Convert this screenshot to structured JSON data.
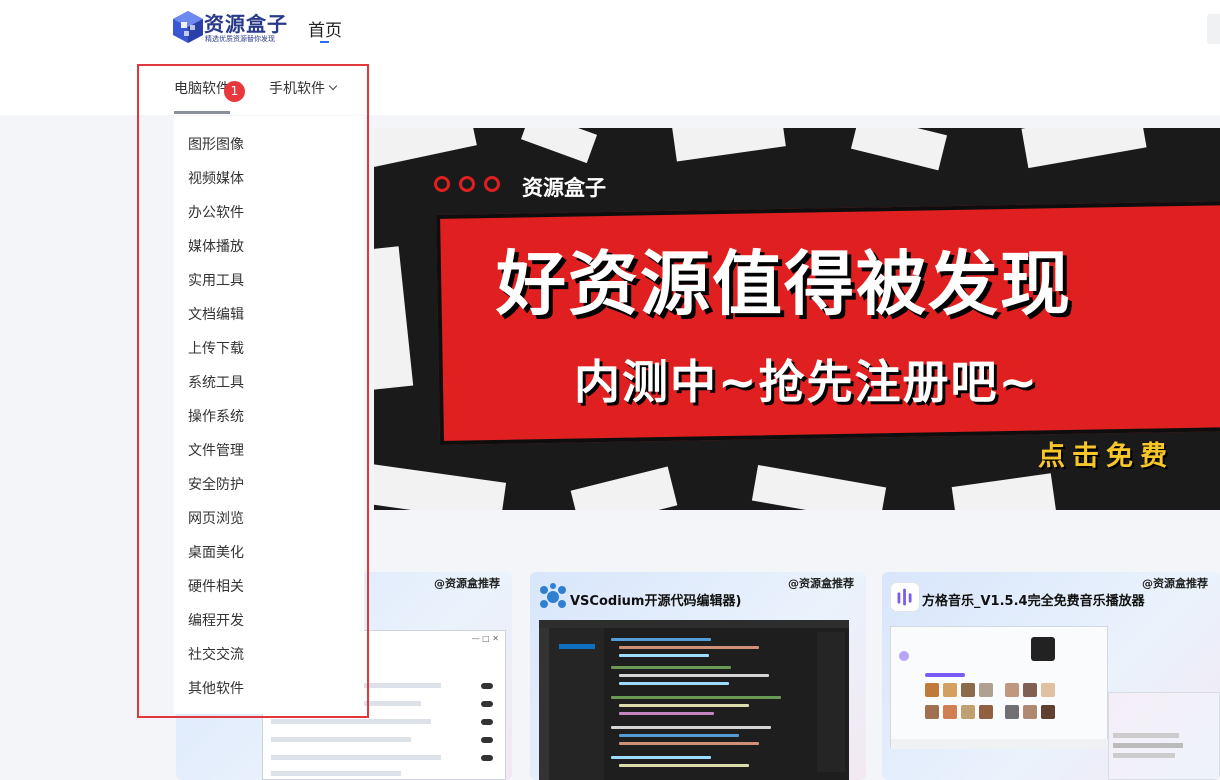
{
  "header": {
    "logo": {
      "title": "资源盒子",
      "subtitle": "精选优质资源替你发现"
    },
    "nav_home": "首页"
  },
  "tabs": {
    "pc": "电脑软件",
    "badge": "1",
    "mobile": "手机软件"
  },
  "dropdown": {
    "items": [
      "图形图像",
      "视频媒体",
      "办公软件",
      "媒体播放",
      "实用工具",
      "文档编辑",
      "上传下载",
      "系统工具",
      "操作系统",
      "文件管理",
      "安全防护",
      "网页浏览",
      "桌面美化",
      "硬件相关",
      "编程开发",
      "社交交流",
      "其他软件"
    ]
  },
  "banner": {
    "brand": "资源盒子",
    "title": "好资源值得被发现",
    "subtitle": "内测中~抢先注册吧~",
    "cta": "点击免费"
  },
  "cards": [
    {
      "tag": "@资源盒推荐",
      "title": ""
    },
    {
      "tag": "@资源盒推荐",
      "title": "VSCodium开源代码编辑器)"
    },
    {
      "tag": "@资源盒推荐",
      "title": "方格音乐_V1.5.4完全免费音乐播放器"
    }
  ],
  "colors": {
    "accent": "#2f6bff",
    "badge": "#e8383d",
    "highlight": "#e2373c",
    "banner_red": "#e02020",
    "cta_yellow": "#f7c629"
  }
}
